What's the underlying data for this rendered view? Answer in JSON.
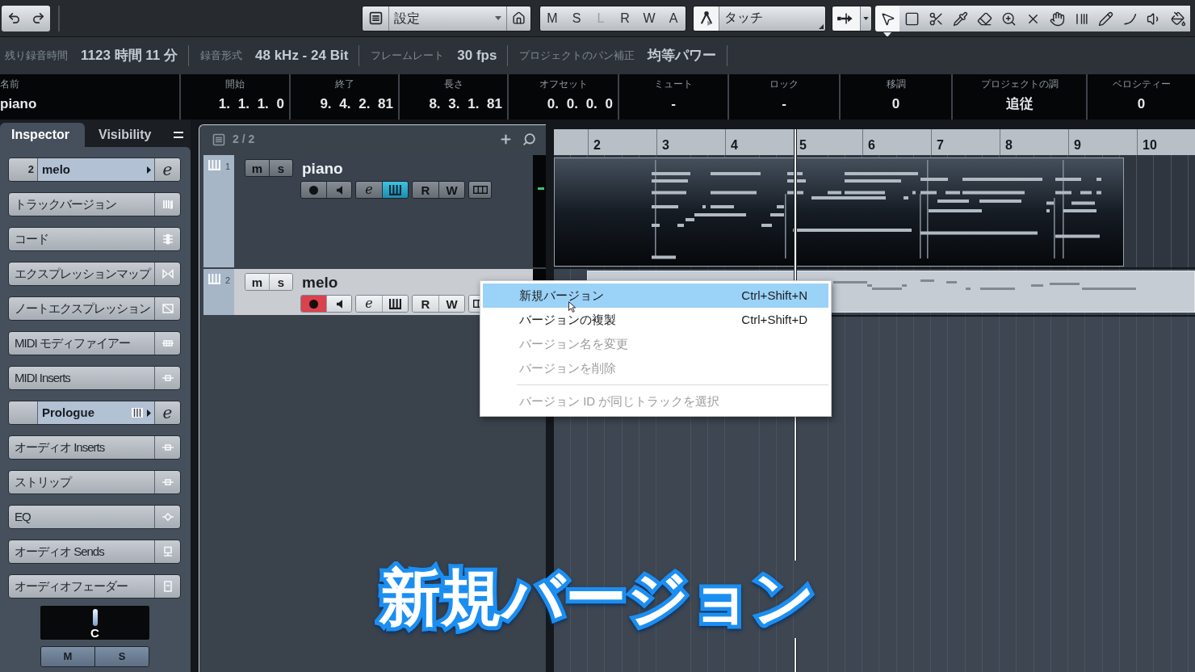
{
  "toolbar": {
    "preset": "設定",
    "automation_buttons": [
      {
        "label": "M",
        "disabled": false
      },
      {
        "label": "S",
        "disabled": false
      },
      {
        "label": "L",
        "disabled": true
      },
      {
        "label": "R",
        "disabled": false
      },
      {
        "label": "W",
        "disabled": false
      },
      {
        "label": "A",
        "disabled": false
      }
    ],
    "automation_mode": "タッチ",
    "tools": [
      {
        "selected": true
      },
      {
        "selected": false
      },
      {
        "selected": false
      },
      {
        "selected": false
      },
      {
        "selected": false
      },
      {
        "selected": false
      },
      {
        "selected": false
      },
      {
        "selected": false
      },
      {
        "selected": false
      },
      {
        "selected": false
      },
      {
        "selected": false
      },
      {
        "selected": false
      },
      {
        "selected": false
      }
    ]
  },
  "status_line": [
    {
      "label": "残り録音時間",
      "value": "1123 時間 11 分"
    },
    {
      "label": "録音形式",
      "value": "48 kHz - 24 Bit"
    },
    {
      "label": "フレームレート",
      "value": "30 fps"
    },
    {
      "label": "プロジェクトのパン補正",
      "value": "均等パワー"
    }
  ],
  "event_info": [
    {
      "label": "名前",
      "value": "piano"
    },
    {
      "label": "開始",
      "value": "1. 1. 1. 0"
    },
    {
      "label": "終了",
      "value": "9. 4. 2. 81"
    },
    {
      "label": "長さ",
      "value": "8. 3. 1. 81"
    },
    {
      "label": "オフセット",
      "value": "0. 0. 0. 0"
    },
    {
      "label": "ミュート",
      "value": "-"
    },
    {
      "label": "ロック",
      "value": "-"
    },
    {
      "label": "移調",
      "value": "0"
    },
    {
      "label": "プロジェクトの調",
      "value": "追従"
    },
    {
      "label": "ベロシティー",
      "value": "0"
    }
  ],
  "inspector": {
    "tabs": [
      {
        "label": "Inspector",
        "selected": true
      },
      {
        "label": "Visibility",
        "selected": false
      }
    ],
    "sections": [
      {
        "kind": "track",
        "number": "2",
        "label": "melo",
        "edit_label": "e"
      },
      {
        "kind": "section",
        "label": "トラックバージョン"
      },
      {
        "kind": "section",
        "label": "コード"
      },
      {
        "kind": "section",
        "label": "エクスプレッションマップ"
      },
      {
        "kind": "section",
        "label": "ノートエクスプレッション"
      },
      {
        "kind": "section",
        "label": "MIDI モディファイアー"
      },
      {
        "kind": "section",
        "label": "MIDI Inserts"
      },
      {
        "kind": "instrument",
        "label": "Prologue",
        "edit_label": "e"
      },
      {
        "kind": "section",
        "label": "オーディオ Inserts"
      },
      {
        "kind": "section",
        "label": "ストリップ"
      },
      {
        "kind": "section",
        "label": "EQ"
      },
      {
        "kind": "section",
        "label": "オーディオ Sends"
      },
      {
        "kind": "section",
        "label": "オーディオフェーダー"
      }
    ],
    "pan": "C",
    "buttons": [
      "M",
      "S"
    ]
  },
  "track_list": {
    "count": "2 / 2",
    "tracks": [
      {
        "number": "1",
        "name": "piano",
        "selected": false,
        "controls": [
          {
            "kind": "mute",
            "label": "m",
            "on": false
          },
          {
            "kind": "solo",
            "label": "s",
            "on": false
          },
          {
            "kind": "record",
            "on": false
          },
          {
            "kind": "monitor",
            "on": false
          },
          {
            "kind": "edit",
            "label": "e",
            "on": false
          },
          {
            "kind": "keys",
            "on": true
          },
          {
            "kind": "read",
            "label": "R",
            "on": false
          },
          {
            "kind": "write",
            "label": "W",
            "on": false
          },
          {
            "kind": "lanes",
            "on": false
          }
        ]
      },
      {
        "number": "2",
        "name": "melo",
        "selected": true,
        "controls": [
          {
            "kind": "mute",
            "label": "m",
            "on": false
          },
          {
            "kind": "solo",
            "label": "s",
            "on": false
          },
          {
            "kind": "record",
            "on": true
          },
          {
            "kind": "monitor",
            "on": false
          },
          {
            "kind": "edit",
            "label": "e",
            "on": false
          },
          {
            "kind": "keys",
            "on": false
          },
          {
            "kind": "read",
            "label": "R",
            "on": false
          },
          {
            "kind": "write",
            "label": "W",
            "on": false
          },
          {
            "kind": "lanes",
            "on": false
          }
        ]
      }
    ]
  },
  "ruler": [
    "2",
    "3",
    "4",
    "5",
    "6",
    "7",
    "8",
    "9",
    "10"
  ],
  "context_menu": [
    {
      "label": "新規バージョン",
      "shortcut": "Ctrl+Shift+N",
      "selected": true,
      "disabled": false,
      "separator_before": false
    },
    {
      "label": "バージョンの複製",
      "shortcut": "Ctrl+Shift+D",
      "selected": false,
      "disabled": false,
      "separator_before": false
    },
    {
      "label": "バージョン名を変更",
      "selected": false,
      "disabled": true,
      "separator_before": false
    },
    {
      "label": "バージョンを削除",
      "selected": false,
      "disabled": true,
      "separator_before": false
    },
    {
      "label": "バージョン ID が同じトラックを選択",
      "selected": false,
      "disabled": true,
      "separator_before": true
    }
  ],
  "caption": "新規バージョン"
}
